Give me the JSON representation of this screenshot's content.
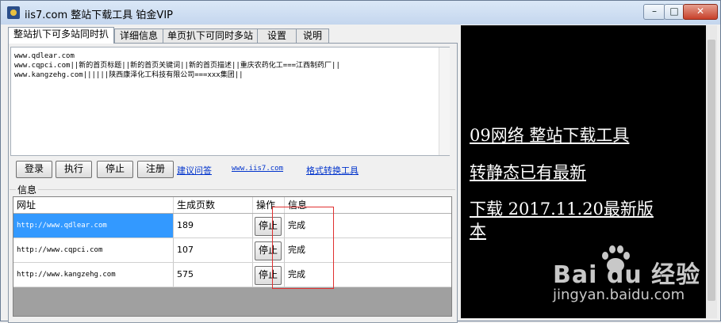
{
  "window": {
    "title": "iis7.com 整站下载工具 铂金VIP",
    "controls": {
      "min": "–",
      "max": "□",
      "close": "✕"
    }
  },
  "tabs": [
    {
      "label": "整站扒下可多站同时扒"
    },
    {
      "label": "详细信息"
    },
    {
      "label": "单页扒下可同时多站"
    },
    {
      "label": "设置"
    },
    {
      "label": "说明"
    }
  ],
  "input": {
    "text": "www.qdlear.com\nwww.cqpci.com||新的首页标题||新的首页关键词||新的首页描述||重庆农药化工===江西制药厂||\nwww.kangzehg.com||||||陕西康泽化工科技有限公司===xxx集团||"
  },
  "buttons": {
    "login": "登录",
    "execute": "执行",
    "stop": "停止",
    "register": "注册"
  },
  "links": {
    "suggest": "建议问答",
    "site": "www.iis7.com",
    "convert": "格式转换工具"
  },
  "info_group": {
    "label": "信息"
  },
  "grid": {
    "columns": [
      "网址",
      "生成页数",
      "操作",
      "信息"
    ],
    "rows": [
      {
        "url": "http://www.qdlear.com",
        "pages": "189",
        "action": "停止",
        "info": "完成"
      },
      {
        "url": "http://www.cqpci.com",
        "pages": "107",
        "action": "停止",
        "info": "完成"
      },
      {
        "url": "http://www.kangzehg.com",
        "pages": "575",
        "action": "停止",
        "info": "完成"
      }
    ]
  },
  "ad": {
    "line1": "09网络 整站下载工具",
    "line2": "转静态已有最新",
    "line3a": "下载 2017.11.20最新版",
    "line3b": "本"
  },
  "watermark": {
    "logo": "Bai du 经验",
    "url": "jingyan.baidu.com"
  },
  "colors": {
    "selection": "#3399ff",
    "link": "#0033cc",
    "ad_bg": "#000000",
    "highlight_box": "#e03030"
  }
}
